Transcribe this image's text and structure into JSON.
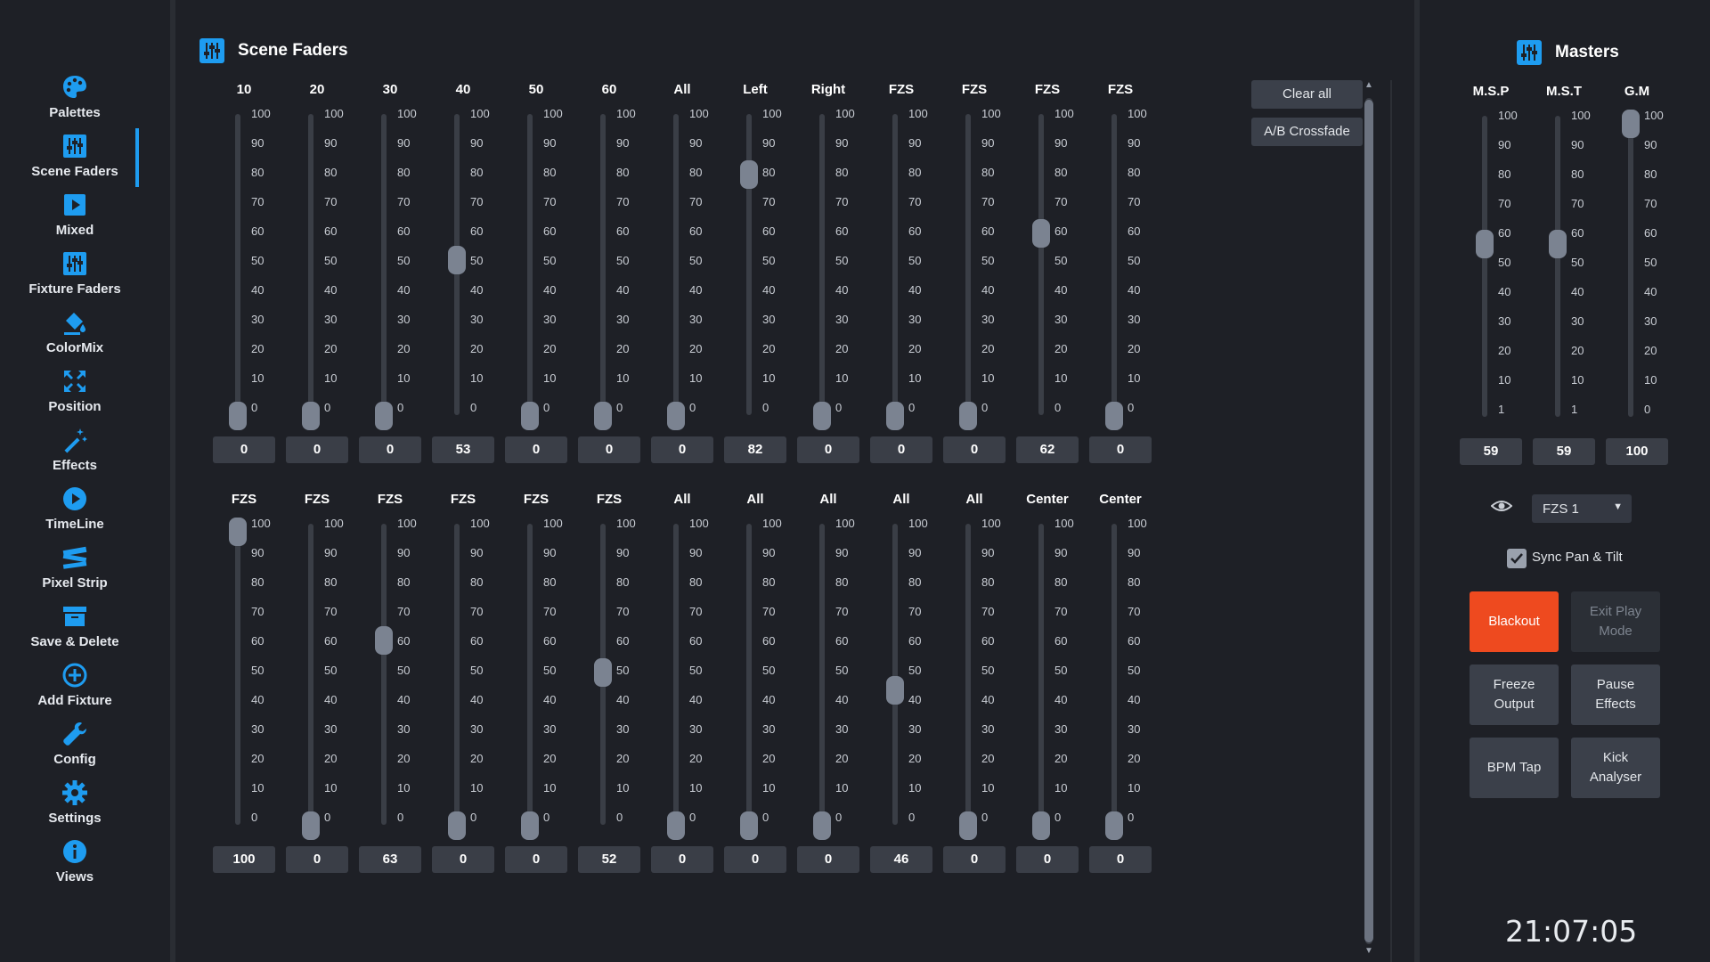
{
  "sidebar": {
    "items": [
      {
        "label": "Palettes",
        "icon": "palette-icon"
      },
      {
        "label": "Scene Faders",
        "icon": "faders-icon",
        "active": true
      },
      {
        "label": "Mixed",
        "icon": "play-square-icon"
      },
      {
        "label": "Fixture Faders",
        "icon": "faders-icon"
      },
      {
        "label": "ColorMix",
        "icon": "paint-bucket-icon"
      },
      {
        "label": "Position",
        "icon": "move-arrows-icon"
      },
      {
        "label": "Effects",
        "icon": "magic-wand-icon"
      },
      {
        "label": "TimeLine",
        "icon": "play-circle-icon"
      },
      {
        "label": "Pixel Strip",
        "icon": "film-strip-icon"
      },
      {
        "label": "Save & Delete",
        "icon": "archive-box-icon"
      },
      {
        "label": "Add Fixture",
        "icon": "plus-circle-icon"
      },
      {
        "label": "Config",
        "icon": "wrench-icon"
      },
      {
        "label": "Settings",
        "icon": "gear-icon"
      },
      {
        "label": "Views",
        "icon": "info-circle-icon"
      }
    ]
  },
  "scene": {
    "title": "Scene Faders",
    "ticks": [
      "100",
      "90",
      "80",
      "70",
      "60",
      "50",
      "40",
      "30",
      "20",
      "10",
      "0"
    ],
    "row1": [
      {
        "label": "10",
        "value": "0",
        "level": 0
      },
      {
        "label": "20",
        "value": "0",
        "level": 0
      },
      {
        "label": "30",
        "value": "0",
        "level": 0
      },
      {
        "label": "40",
        "value": "53",
        "level": 53
      },
      {
        "label": "50",
        "value": "0",
        "level": 0
      },
      {
        "label": "60",
        "value": "0",
        "level": 0
      },
      {
        "label": "All",
        "value": "0",
        "level": 0
      },
      {
        "label": "Left",
        "value": "82",
        "level": 82
      },
      {
        "label": "Right",
        "value": "0",
        "level": 0
      },
      {
        "label": "FZS",
        "value": "0",
        "level": 0
      },
      {
        "label": "FZS",
        "value": "0",
        "level": 0
      },
      {
        "label": "FZS",
        "value": "62",
        "level": 62
      },
      {
        "label": "FZS",
        "value": "0",
        "level": 0
      }
    ],
    "row2": [
      {
        "label": "FZS",
        "value": "100",
        "level": 100
      },
      {
        "label": "FZS",
        "value": "0",
        "level": 0
      },
      {
        "label": "FZS",
        "value": "63",
        "level": 63
      },
      {
        "label": "FZS",
        "value": "0",
        "level": 0
      },
      {
        "label": "FZS",
        "value": "0",
        "level": 0
      },
      {
        "label": "FZS",
        "value": "52",
        "level": 52
      },
      {
        "label": "All",
        "value": "0",
        "level": 0
      },
      {
        "label": "All",
        "value": "0",
        "level": 0
      },
      {
        "label": "All",
        "value": "0",
        "level": 0
      },
      {
        "label": "All",
        "value": "46",
        "level": 46
      },
      {
        "label": "All",
        "value": "0",
        "level": 0
      },
      {
        "label": "Center",
        "value": "0",
        "level": 0
      },
      {
        "label": "Center",
        "value": "0",
        "level": 0
      }
    ],
    "buttons": {
      "clear_all": "Clear all",
      "ab_crossfade": "A/B Crossfade"
    }
  },
  "masters": {
    "title": "Masters",
    "ticks_a": [
      "100",
      "90",
      "80",
      "70",
      "60",
      "50",
      "40",
      "30",
      "20",
      "10",
      "1"
    ],
    "ticks_b": [
      "100",
      "90",
      "80",
      "70",
      "60",
      "50",
      "40",
      "30",
      "20",
      "10",
      "0"
    ],
    "faders": [
      {
        "label": "M.S.P",
        "value": "59",
        "level": 59
      },
      {
        "label": "M.S.T",
        "value": "59",
        "level": 59
      },
      {
        "label": "G.M",
        "value": "100",
        "level": 100
      }
    ],
    "fixture_select": "FZS 1",
    "sync_label": "Sync Pan & Tilt",
    "sync_checked": true,
    "buttons": {
      "blackout": "Blackout",
      "exit_play": "Exit Play Mode",
      "freeze": "Freeze Output",
      "pause": "Pause Effects",
      "bpm": "BPM Tap",
      "kick": "Kick Analyser"
    },
    "clock": "21:07:05"
  },
  "colors": {
    "accent": "#1e9cf0",
    "blackout": "#ee4a1f",
    "background": "#1e2026",
    "button": "#3b404a"
  }
}
